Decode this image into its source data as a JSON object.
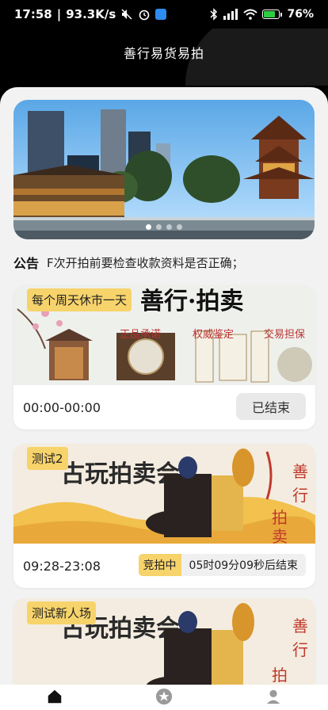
{
  "status_bar": {
    "time": "17:58",
    "speed": "93.3K/s",
    "battery": "76%"
  },
  "header": {
    "title": "善行易货易拍"
  },
  "banner": {
    "dots": 4,
    "active_dot": 0
  },
  "notice": {
    "label": "公告",
    "text": "F次开拍前要检查收款资料是否正确；"
  },
  "cards": [
    {
      "tag": "每个周天休市一天",
      "banner_title": "善行·拍卖",
      "badges": [
        "正品承诺",
        "权威鉴定",
        "交易担保"
      ],
      "time": "00:00-00:00",
      "status": "已结束"
    },
    {
      "tag": "测试2",
      "banner_title": "古玩拍卖会",
      "side_text": [
        "善",
        "行",
        "拍",
        "卖"
      ],
      "time": "09:28-23:08",
      "status_badge": "竞拍中",
      "countdown": "05时09分09秒后结束"
    },
    {
      "tag": "测试新人场",
      "banner_title": "古玩拍卖会",
      "side_text": [
        "善",
        "行",
        "拍"
      ]
    }
  ],
  "tabbar": {
    "items": [
      {
        "name": "home-icon",
        "active": true
      },
      {
        "name": "star-icon",
        "active": false
      },
      {
        "name": "user-icon",
        "active": false
      }
    ]
  },
  "colors": {
    "accent": "#f7d36b",
    "header_bg": "#000000",
    "page_bg": "#f2f2f2"
  }
}
